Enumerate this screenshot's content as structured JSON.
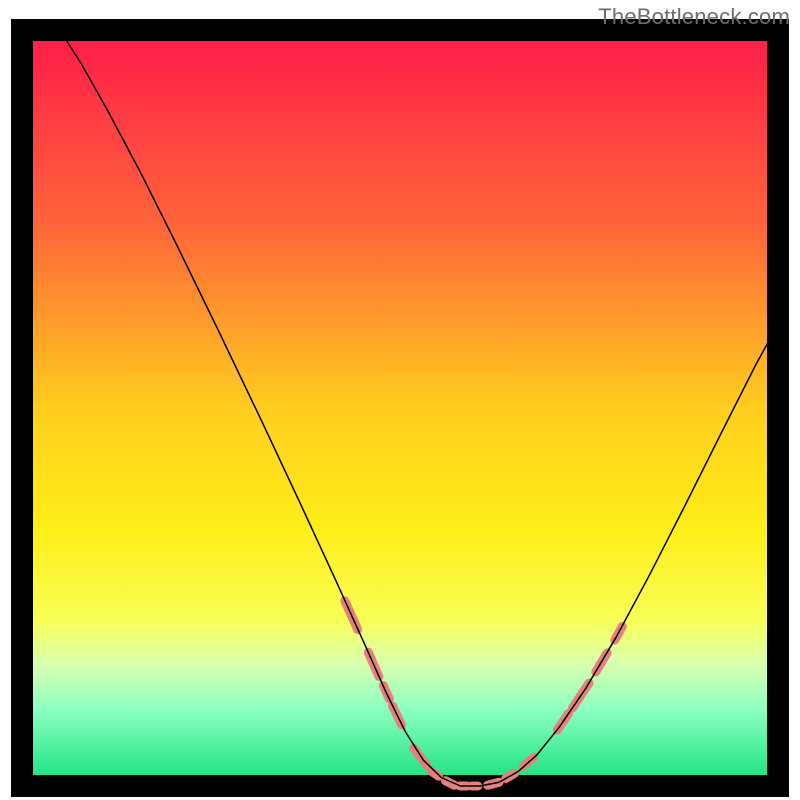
{
  "watermark": "TheBottleneck.com",
  "chart_data": {
    "type": "line",
    "title": "",
    "xlabel": "",
    "ylabel": "",
    "xlim": [
      0,
      100
    ],
    "ylim": [
      0,
      100
    ],
    "background": {
      "gradient_stops": [
        {
          "offset": 0,
          "color": "#ff1a4b"
        },
        {
          "offset": 26,
          "color": "#ff6638"
        },
        {
          "offset": 50,
          "color": "#ffcd1f"
        },
        {
          "offset": 66,
          "color": "#ffee18"
        },
        {
          "offset": 78,
          "color": "#f8ff56"
        },
        {
          "offset": 84,
          "color": "#d7ffb0"
        },
        {
          "offset": 90,
          "color": "#8affc0"
        },
        {
          "offset": 100,
          "color": "#12e07a"
        }
      ]
    },
    "series": [
      {
        "name": "bottleneck-curve",
        "color": "#000000",
        "stroke_width": 1.5,
        "points": [
          {
            "x": 5.0,
            "y": 100.0
          },
          {
            "x": 7.8,
            "y": 95.6
          },
          {
            "x": 11.3,
            "y": 89.4
          },
          {
            "x": 15.6,
            "y": 81.3
          },
          {
            "x": 20.5,
            "y": 71.5
          },
          {
            "x": 26.0,
            "y": 60.2
          },
          {
            "x": 31.5,
            "y": 48.7
          },
          {
            "x": 36.8,
            "y": 37.4
          },
          {
            "x": 41.5,
            "y": 27.2
          },
          {
            "x": 45.3,
            "y": 18.8
          },
          {
            "x": 48.2,
            "y": 12.3
          },
          {
            "x": 50.7,
            "y": 7.2
          },
          {
            "x": 53.1,
            "y": 3.4
          },
          {
            "x": 55.5,
            "y": 1.1
          },
          {
            "x": 58.0,
            "y": 0.0
          },
          {
            "x": 60.6,
            "y": 0.0
          },
          {
            "x": 63.1,
            "y": 0.5
          },
          {
            "x": 65.6,
            "y": 1.9
          },
          {
            "x": 68.1,
            "y": 4.1
          },
          {
            "x": 71.0,
            "y": 7.7
          },
          {
            "x": 74.5,
            "y": 12.8
          },
          {
            "x": 78.6,
            "y": 19.7
          },
          {
            "x": 83.0,
            "y": 27.9
          },
          {
            "x": 87.7,
            "y": 37.1
          },
          {
            "x": 92.5,
            "y": 46.7
          },
          {
            "x": 97.0,
            "y": 55.6
          },
          {
            "x": 100.0,
            "y": 61.1
          }
        ]
      }
    ],
    "highlights": {
      "color": "#e58080",
      "thickness": 9,
      "segments": [
        [
          {
            "x": 42.7,
            "y": 24.5
          },
          {
            "x": 44.4,
            "y": 20.7
          }
        ],
        [
          {
            "x": 45.8,
            "y": 17.7
          },
          {
            "x": 47.2,
            "y": 14.5
          }
        ],
        [
          {
            "x": 47.8,
            "y": 13.3
          },
          {
            "x": 48.6,
            "y": 11.5
          }
        ],
        [
          {
            "x": 49.0,
            "y": 10.6
          },
          {
            "x": 50.2,
            "y": 8.1
          }
        ],
        [
          {
            "x": 51.8,
            "y": 5.0
          },
          {
            "x": 53.5,
            "y": 2.8
          }
        ],
        [
          {
            "x": 54.1,
            "y": 2.0
          },
          {
            "x": 55.1,
            "y": 1.3
          }
        ],
        [
          {
            "x": 56.0,
            "y": 0.7
          },
          {
            "x": 57.2,
            "y": 0.1
          }
        ],
        [
          {
            "x": 57.9,
            "y": 0.0
          },
          {
            "x": 58.9,
            "y": 0.0
          }
        ],
        [
          {
            "x": 59.5,
            "y": 0.0
          },
          {
            "x": 60.3,
            "y": 0.0
          }
        ],
        [
          {
            "x": 61.6,
            "y": 0.1
          },
          {
            "x": 63.1,
            "y": 0.5
          }
        ],
        [
          {
            "x": 64.0,
            "y": 1.0
          },
          {
            "x": 65.2,
            "y": 1.7
          }
        ],
        [
          {
            "x": 66.3,
            "y": 2.6
          },
          {
            "x": 67.7,
            "y": 3.8
          }
        ],
        [
          {
            "x": 70.8,
            "y": 7.4
          },
          {
            "x": 72.3,
            "y": 9.6
          }
        ],
        [
          {
            "x": 72.8,
            "y": 10.3
          },
          {
            "x": 75.0,
            "y": 13.6
          }
        ],
        [
          {
            "x": 75.9,
            "y": 15.1
          },
          {
            "x": 77.4,
            "y": 17.6
          }
        ],
        [
          {
            "x": 78.4,
            "y": 19.3
          },
          {
            "x": 79.4,
            "y": 21.1
          }
        ]
      ]
    }
  }
}
